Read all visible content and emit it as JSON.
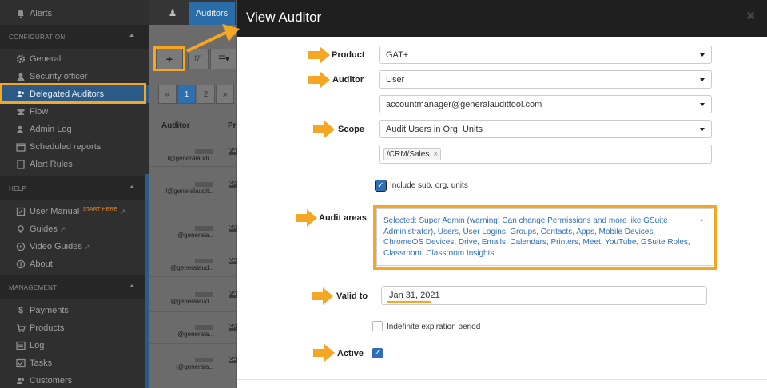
{
  "sidebar": {
    "alerts": "Alerts",
    "sections": {
      "configuration": "CONFIGURATION",
      "help": "HELP",
      "management": "MANAGEMENT"
    },
    "config_items": [
      "General",
      "Security officer",
      "Delegated Auditors",
      "Flow",
      "Admin Log",
      "Scheduled reports",
      "Alert Rules"
    ],
    "help_items": [
      "User Manual",
      "Guides",
      "Video Guides",
      "About"
    ],
    "start_here": "START HERE",
    "management_items": [
      "Payments",
      "Products",
      "Log",
      "Tasks",
      "Customers"
    ]
  },
  "background": {
    "tab_auditors": "Auditors",
    "add_glyph": "+",
    "pages": [
      "«",
      "1",
      "2",
      "»"
    ],
    "col_auditor": "Auditor",
    "col_product": "Pr",
    "rows": [
      {
        "email": "l@generalaudi...",
        "badge": "GA"
      },
      {
        "email": "l@generalaudit...",
        "badge": "GA"
      },
      {
        "email": "@generala...",
        "badge": "GA"
      },
      {
        "email": "@generalaud...",
        "badge": "GA"
      },
      {
        "email": "@generalaud...",
        "badge": "GA"
      },
      {
        "email": "@generala...",
        "badge": "GA"
      },
      {
        "email": "i@generala...",
        "badge": "GA"
      }
    ]
  },
  "modal": {
    "title": "View Auditor",
    "close_glyph": "✖",
    "product_label": "Product",
    "product_value": "GAT+",
    "auditor_label": "Auditor",
    "auditor_value": "User",
    "auditor_email": "accountmanager@generalaudittool.com",
    "scope_label": "Scope",
    "scope_value": "Audit Users in Org. Units",
    "scope_tag": "/CRM/Sales",
    "include_sub_label": "Include sub. org. units",
    "audit_areas_label": "Audit areas",
    "audit_areas_value": "Selected: Super Admin (warning! Can change Permissions and more like GSuite Administrator), Users, User Logins, Groups, Contacts, Apps, Mobile Devices, ChromeOS Devices, Drive, Emails, Calendars, Printers, Meet, YouTube, GSuite Roles, Classroom, Classroom Insights",
    "valid_to_label": "Valid to",
    "valid_to_value": "Jan 31, 2021",
    "indefinite_label": "Indefinite expiration period",
    "active_label": "Active"
  },
  "colors": {
    "highlight": "#f5a623",
    "primary": "#2d6fb7",
    "sidebar_bg": "#2f2f2f"
  }
}
